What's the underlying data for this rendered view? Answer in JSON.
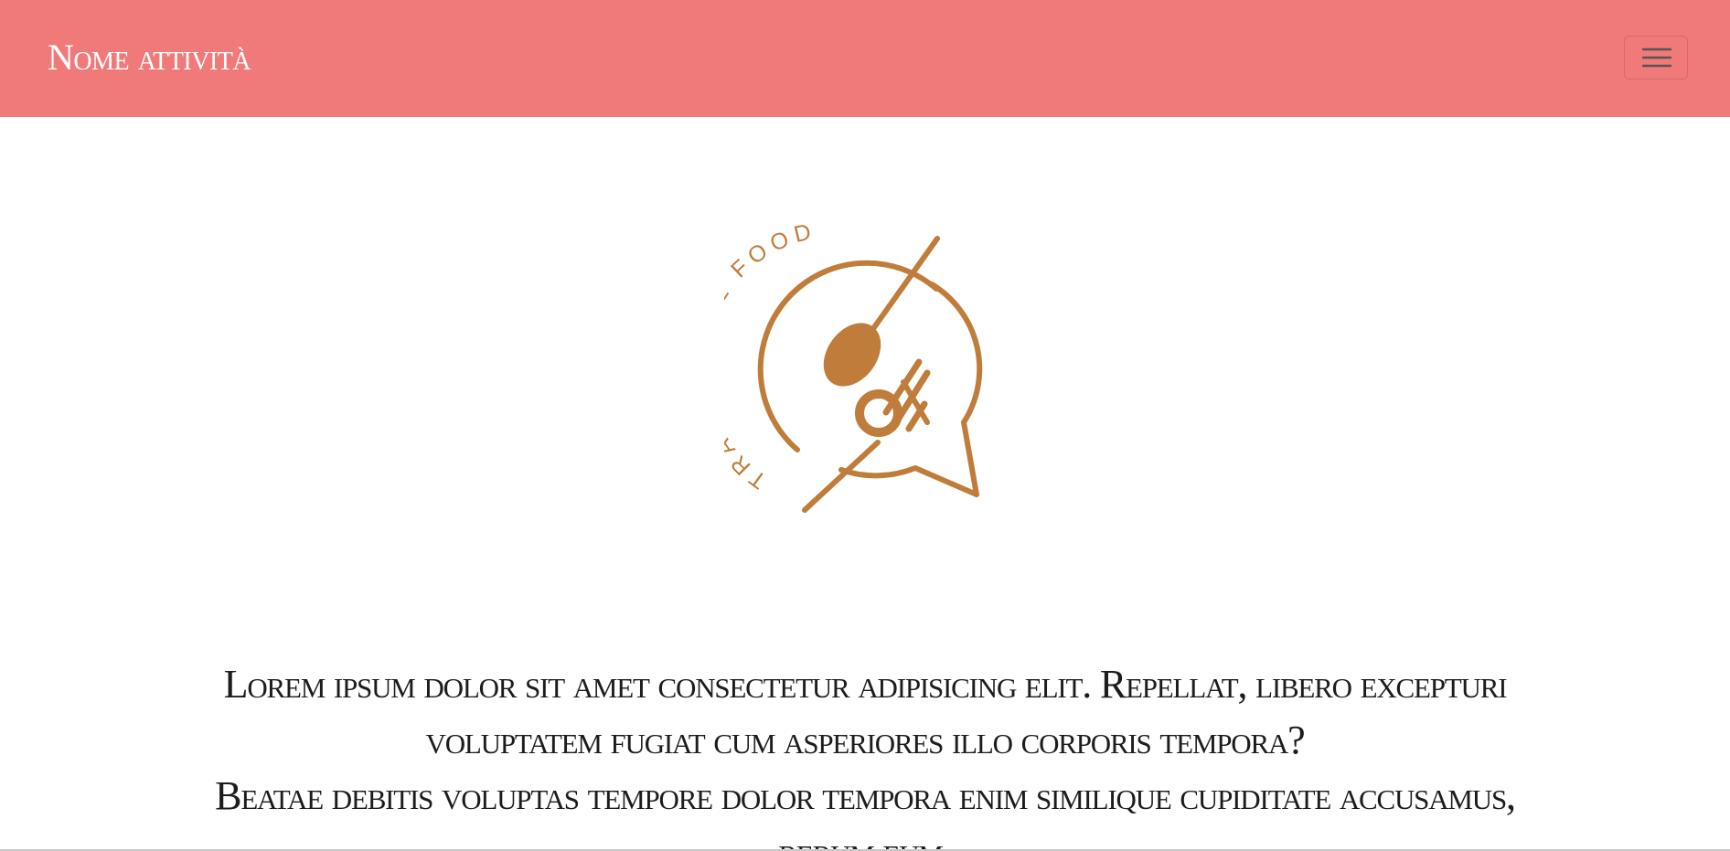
{
  "navbar": {
    "brand": "Nome attività",
    "background": "#f07a7a",
    "toggle_icon": "hamburger-menu-icon"
  },
  "logo": {
    "arc_text": "TRADITIONAL FOOD",
    "color": "#c07c3a",
    "icons": [
      "speech-bubble-icon",
      "spoon-icon",
      "fork-icon"
    ]
  },
  "main": {
    "paragraph_1": "Lorem ipsum dolor sit amet consectetur adipisicing elit. Repellat, libero excepturi voluptatem fugiat cum asperiores illo corporis tempora?",
    "paragraph_2": "Beatae debitis voluptas tempore dolor tempora enim similique cupiditate accusamus, rerum eum."
  }
}
